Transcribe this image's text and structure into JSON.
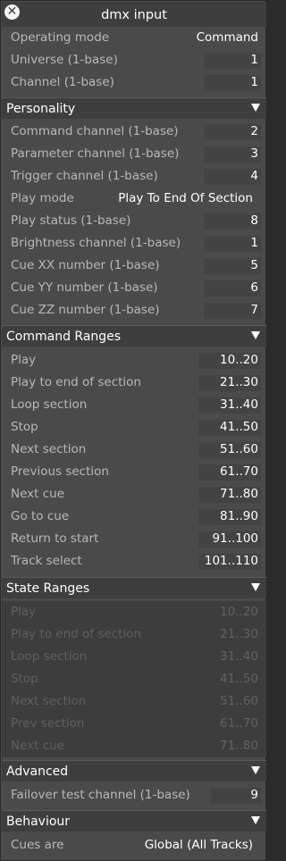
{
  "window": {
    "title": "dmx input"
  },
  "top": [
    {
      "label": "Operating mode",
      "value": "Command"
    },
    {
      "label": "Universe (1-base)",
      "value": "1"
    },
    {
      "label": "Channel (1-base)",
      "value": "1"
    }
  ],
  "personality": {
    "title": "Personality",
    "rows": [
      {
        "label": "Command channel (1-base)",
        "value": "2"
      },
      {
        "label": "Parameter channel (1-base)",
        "value": "3"
      },
      {
        "label": "Trigger channel (1-base)",
        "value": "4"
      },
      {
        "label": "Play mode",
        "value": "Play To End Of Section"
      },
      {
        "label": "Play status (1-base)",
        "value": "8"
      },
      {
        "label": "Brightness channel (1-base)",
        "value": "1"
      },
      {
        "label": "Cue XX number (1-base)",
        "value": "5"
      },
      {
        "label": "Cue YY number (1-base)",
        "value": "6"
      },
      {
        "label": "Cue ZZ number (1-base)",
        "value": "7"
      }
    ]
  },
  "command_ranges": {
    "title": "Command Ranges",
    "rows": [
      {
        "label": "Play",
        "value": "10..20"
      },
      {
        "label": "Play to end of section",
        "value": "21..30"
      },
      {
        "label": "Loop section",
        "value": "31..40"
      },
      {
        "label": "Stop",
        "value": "41..50"
      },
      {
        "label": "Next section",
        "value": "51..60"
      },
      {
        "label": "Previous section",
        "value": "61..70"
      },
      {
        "label": "Next cue",
        "value": "71..80"
      },
      {
        "label": "Go to cue",
        "value": "81..90"
      },
      {
        "label": "Return to start",
        "value": "91..100"
      },
      {
        "label": "Track select",
        "value": "101..110"
      }
    ]
  },
  "state_ranges": {
    "title": "State Ranges",
    "rows": [
      {
        "label": "Play",
        "value": "10..20"
      },
      {
        "label": "Play to end of section",
        "value": "21..30"
      },
      {
        "label": "Loop section",
        "value": "31..40"
      },
      {
        "label": "Stop",
        "value": "41..50"
      },
      {
        "label": "Next section",
        "value": "51..60"
      },
      {
        "label": "Prev section",
        "value": "61..70"
      },
      {
        "label": "Next cue",
        "value": "71..80"
      }
    ]
  },
  "advanced": {
    "title": "Advanced",
    "rows": [
      {
        "label": "Failover test channel (1-base)",
        "value": "9"
      }
    ]
  },
  "behaviour": {
    "title": "Behaviour",
    "rows": [
      {
        "label": "Cues are",
        "value": "Global (All Tracks)"
      }
    ]
  }
}
